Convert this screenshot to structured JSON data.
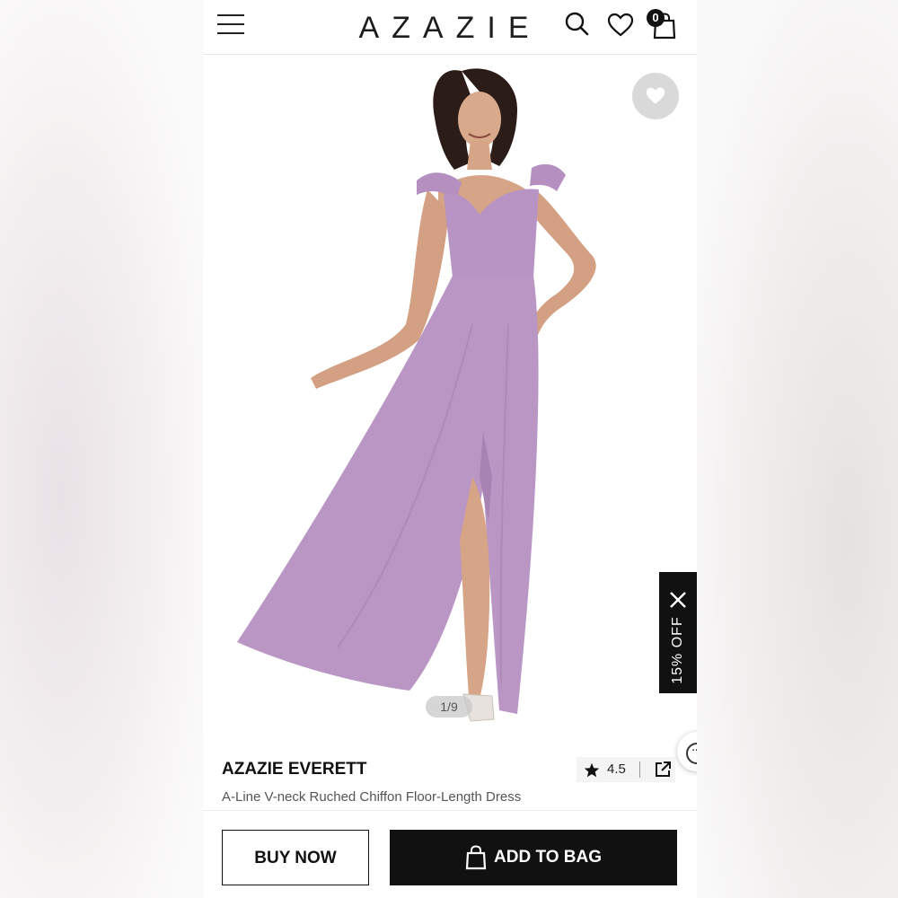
{
  "header": {
    "logo": "AZAZIE",
    "bag_count": "0"
  },
  "product_image": {
    "counter": "1/9",
    "dress_color": "#b996c4"
  },
  "promo": {
    "label": "15% OFF"
  },
  "product": {
    "name": "AZAZIE EVERETT",
    "description": "A-Line V-neck Ruched Chiffon Floor-Length Dress",
    "rating": "4.5"
  },
  "actions": {
    "buy_now": "BUY NOW",
    "add_to_bag": "ADD TO BAG"
  },
  "icons": {
    "menu": "hamburger-menu-icon",
    "search": "search-icon",
    "wishlist": "heart-icon",
    "bag": "shopping-bag-icon",
    "share": "share-icon",
    "star": "star-icon",
    "close": "close-icon",
    "chat": "chat-icon"
  }
}
